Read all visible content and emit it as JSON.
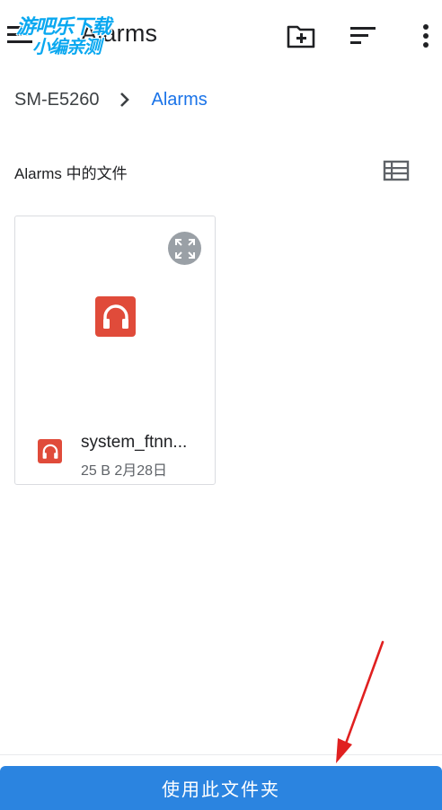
{
  "appbar": {
    "title": "Alarms",
    "icons": [
      "menu-icon",
      "new-folder-icon",
      "sort-icon",
      "more-vert-icon"
    ]
  },
  "watermark": {
    "line1": "游吧乐下载",
    "line2": "小编亲测"
  },
  "breadcrumb": {
    "root": "SM-E5260",
    "current": "Alarms"
  },
  "section": {
    "label": "Alarms 中的文件",
    "view_icon": "list-view-icon"
  },
  "files": [
    {
      "name": "system_ftnn...",
      "size": "25 B",
      "date": "2月28日",
      "info": "25 B 2月28日",
      "icon": "headphones-audio-icon"
    }
  ],
  "bottom_button": {
    "label": "使用此文件夹"
  },
  "colors": {
    "accent": "#1a73e8",
    "button": "#2b84e0",
    "audio_icon": "#e04b3a",
    "annotation_arrow": "#e02020"
  }
}
